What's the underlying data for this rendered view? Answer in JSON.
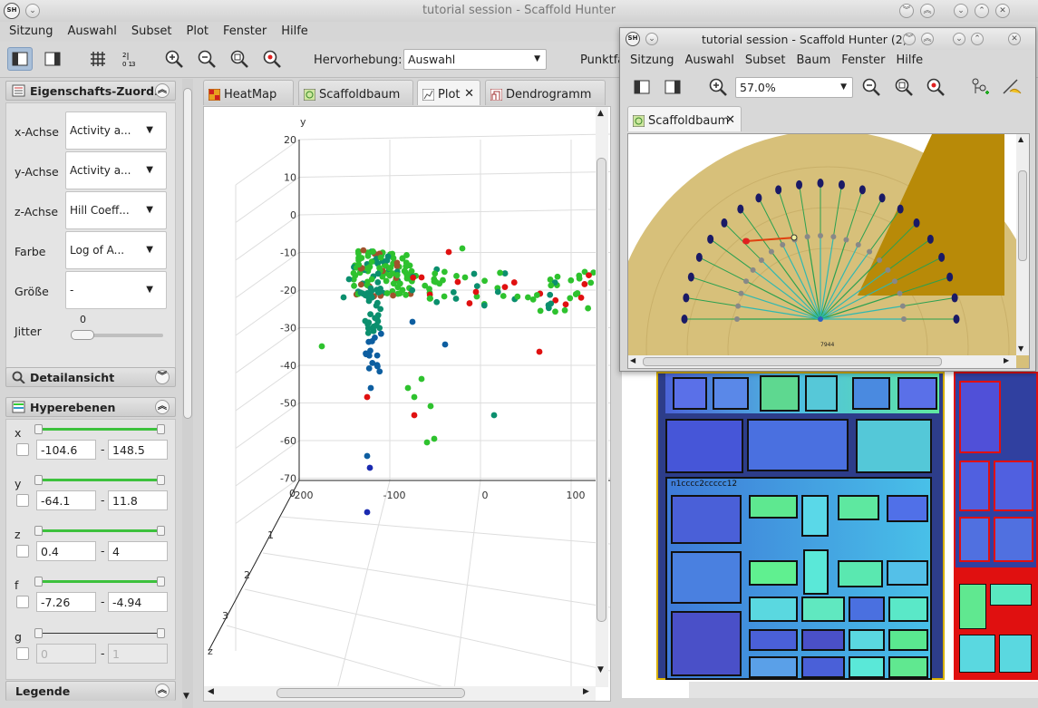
{
  "main_window": {
    "title": "tutorial session - Scaffold Hunter",
    "app_icon": "SH",
    "menu": [
      "Sitzung",
      "Auswahl",
      "Subset",
      "Plot",
      "Fenster",
      "Hilfe"
    ],
    "toolbar": {
      "highlight_label": "Hervorhebung:",
      "highlight_value": "Auswahl",
      "truncated_label": "Punktfa"
    }
  },
  "sidebar": {
    "property_panel": {
      "title": "Eigenschafts-Zuord...",
      "rows": [
        {
          "label": "x-Achse",
          "value": "Activity a..."
        },
        {
          "label": "y-Achse",
          "value": "Activity a..."
        },
        {
          "label": "z-Achse",
          "value": "Hill Coeff..."
        },
        {
          "label": "Farbe",
          "value": "Log of A..."
        },
        {
          "label": "Größe",
          "value": "-"
        }
      ],
      "jitter_label": "Jitter",
      "jitter_value": "0"
    },
    "detail_panel": {
      "title": "Detailansicht"
    },
    "hyperplanes_panel": {
      "title": "Hyperebenen",
      "rows": [
        {
          "label": "x",
          "min": "-104.6",
          "max": "148.5"
        },
        {
          "label": "y",
          "min": "-64.1",
          "max": "11.8"
        },
        {
          "label": "z",
          "min": "0.4",
          "max": "4"
        },
        {
          "label": "f",
          "min": "-7.26",
          "max": "-4.94"
        },
        {
          "label": "g",
          "min": "0",
          "max": "1"
        }
      ],
      "separator": "-"
    },
    "legend_panel": {
      "title": "Legende"
    }
  },
  "tabs": [
    {
      "label": "HeatMap",
      "icon": "heatmap-icon"
    },
    {
      "label": "Scaffoldbaum",
      "icon": "tree-icon"
    },
    {
      "label": "Plot",
      "icon": "plot-icon",
      "selected": true
    },
    {
      "label": "Dendrogramm",
      "icon": "dendrogram-icon"
    }
  ],
  "chart_data": {
    "type": "scatter",
    "xlabel": "",
    "ylabel": "y",
    "zlabel": "z",
    "y_ticks": [
      "20",
      "10",
      "0",
      "-10",
      "-20",
      "-30",
      "-40",
      "-50",
      "-60",
      "-70"
    ],
    "x_ticks": [
      "-200",
      "-100",
      "0",
      "100"
    ],
    "z_ticks": [
      "0",
      "1",
      "2",
      "3"
    ],
    "ylim": [
      -70,
      20
    ],
    "xlim": [
      -200,
      100
    ],
    "colors": {
      "green": "#2ec22e",
      "teal": "#0b8f6e",
      "blue": "#0d5ea0",
      "darkblue": "#1a2ab0",
      "red": "#e01010",
      "brown": "#a0522d"
    }
  },
  "second_window": {
    "title": "tutorial session - Scaffold Hunter (2)",
    "app_icon": "SH",
    "menu": [
      "Sitzung",
      "Auswahl",
      "Subset",
      "Baum",
      "Fenster",
      "Hilfe"
    ],
    "zoom_value": "57.0%",
    "tab_label": "Scaffoldbaum",
    "label_center": "7944"
  },
  "treemap": {
    "labels": [
      "n1cccc2ccccc12"
    ]
  }
}
